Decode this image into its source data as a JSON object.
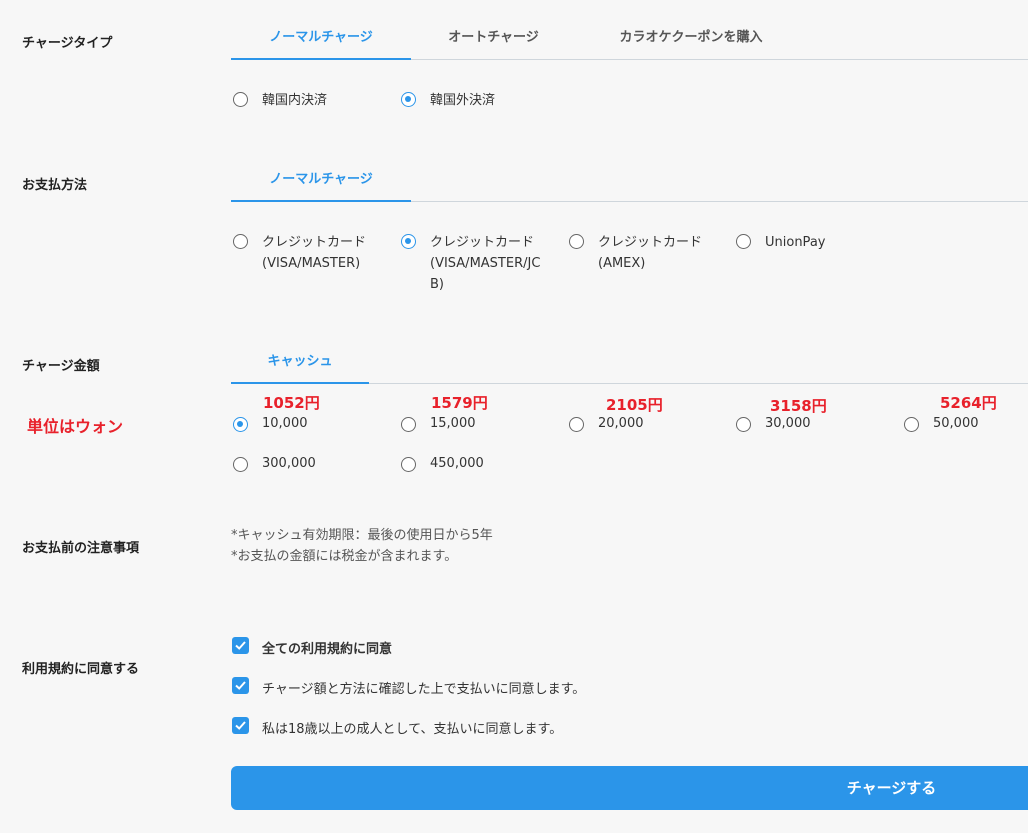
{
  "charge_type": {
    "label": "チャージタイプ",
    "tabs": [
      "ノーマルチャージ",
      "オートチャージ",
      "カラオケクーポンを購入"
    ],
    "region_options": [
      "韓国内決済",
      "韓国外決済"
    ],
    "selected_region": "韓国外決済"
  },
  "payment_method": {
    "label": "お支払方法",
    "tab": "ノーマルチャージ",
    "options": [
      {
        "line1": "クレジットカード",
        "line2": "(VISA/MASTER)",
        "line3": ""
      },
      {
        "line1": "クレジットカード",
        "line2": "(VISA/MASTER/JC",
        "line3": "B)"
      },
      {
        "line1": "クレジットカード",
        "line2": "(AMEX)",
        "line3": ""
      },
      {
        "line1": "UnionPay",
        "line2": "",
        "line3": ""
      }
    ],
    "selected_index": 1
  },
  "charge_amount": {
    "label": "チャージ金額",
    "tab": "キャッシュ",
    "unit_note": "単位はウォン",
    "yen_notes": [
      "1052円",
      "1579円",
      "2105円",
      "3158円",
      "5264円"
    ],
    "amounts": [
      "10,000",
      "15,000",
      "20,000",
      "30,000",
      "50,000",
      "300,000",
      "450,000"
    ],
    "selected": "10,000"
  },
  "pre_payment_notes": {
    "label": "お支払前の注意事項",
    "lines": [
      "*キャッシュ有効期限：最後の使用日から5年",
      "*お支払の金額には税金が含まれます。"
    ]
  },
  "terms": {
    "label": "利用規約に同意する",
    "checkboxes": [
      {
        "text": "全ての利用規約に同意",
        "checked": true
      },
      {
        "text": "チャージ額と方法に確認した上で支払いに同意します。",
        "checked": true
      },
      {
        "text": "私は18歳以上の成人として、支払いに同意します。",
        "checked": true
      }
    ]
  },
  "submit_label": "チャージする",
  "colors": {
    "accent": "#2b95e9",
    "annotation_red": "#e8212b",
    "background": "#f7f7f7"
  }
}
